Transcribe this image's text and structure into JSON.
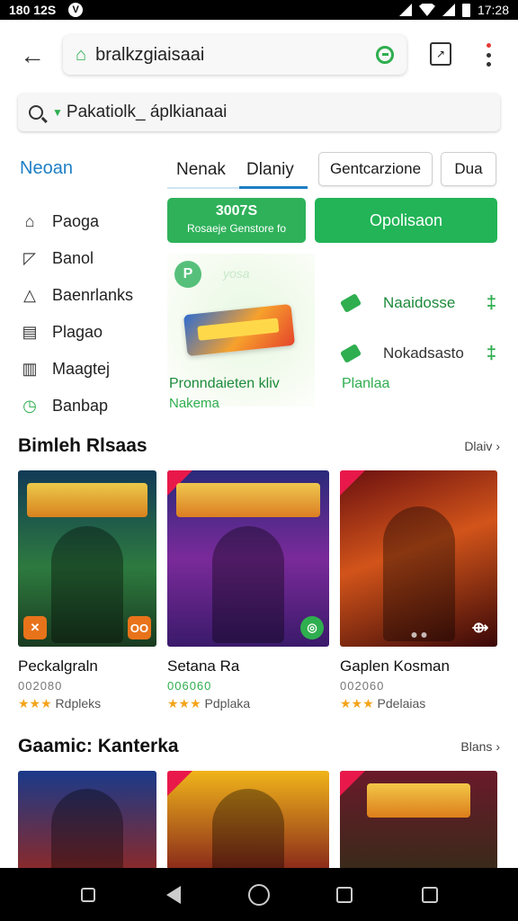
{
  "status": {
    "left_time": "180 12S",
    "right_time": "17:28",
    "logo": "V"
  },
  "browser": {
    "url": "bralkzgiaisaai"
  },
  "search": {
    "query": "Pakatiolk_ áplkianaai"
  },
  "sidebar": {
    "title": "Neoan",
    "items": [
      {
        "label": "Paoga",
        "icon": "leaf-icon"
      },
      {
        "label": "Banol",
        "icon": "tag-icon"
      },
      {
        "label": "Baenrlanks",
        "icon": "bookmark-icon"
      },
      {
        "label": "Plagao",
        "icon": "document-icon"
      },
      {
        "label": "Maagtej",
        "icon": "chart-icon"
      },
      {
        "label": "Banbap",
        "icon": "clock-icon"
      }
    ]
  },
  "tabs": {
    "tab1": "Nenak",
    "tab2": "Dlaniy"
  },
  "chips": {
    "chip1": "Gentcarzione",
    "chip2": "Dua"
  },
  "buttons": {
    "promo_line1": "3007S",
    "promo_line2": "Rosaeje Genstore fo",
    "primary": "Opolisaon"
  },
  "promo": {
    "badge": "P",
    "overlay": "yosa",
    "line1": "Pronndaieten kliv",
    "line2": "Nakema"
  },
  "downloads": [
    {
      "name": "Naaidosse"
    },
    {
      "name": "Nokadsasto"
    }
  ],
  "downloads_label": "Planlaa",
  "section1": {
    "title": "Bimleh Rlsaas",
    "more": "Dlaiv",
    "cards": [
      {
        "name": "Peckalgraln",
        "code": "002080",
        "rating": "Rdpleks",
        "badge": "OO"
      },
      {
        "name": "Setana Ra",
        "code": "006060",
        "rating": "Pdplaka",
        "badge": ""
      },
      {
        "name": "Gaplen Kosman",
        "code": "002060",
        "rating": "Pdelaias",
        "badge": ""
      }
    ]
  },
  "section2": {
    "title": "Gaamic: Kanterka",
    "more": "Blans"
  },
  "stars": "★★★",
  "colors": {
    "accent_blue": "#1e7fc4",
    "accent_green": "#2fb15a",
    "star": "#f4a41b"
  }
}
